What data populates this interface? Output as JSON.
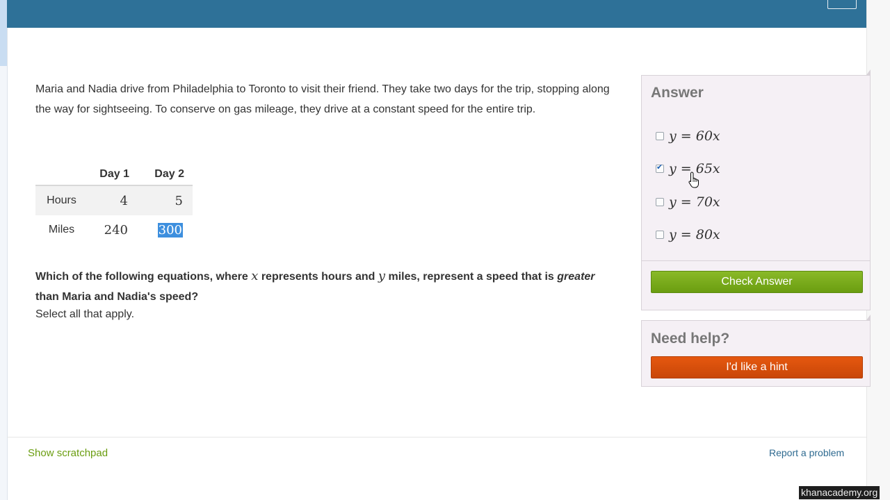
{
  "question": {
    "paragraph": "Maria and Nadia drive from Philadelphia to Toronto to visit their friend. They take two days for the trip, stopping along the way for sightseeing. To conserve on gas mileage, they drive at a constant speed for the entire trip."
  },
  "table": {
    "headers": [
      "",
      "Day 1",
      "Day 2"
    ],
    "rows": [
      {
        "label": "Hours",
        "day1": "4",
        "day2": "5"
      },
      {
        "label": "Miles",
        "day1": "240",
        "day2": "300"
      }
    ]
  },
  "prompt": {
    "part1": "Which of the following equations, where ",
    "x": "x",
    "part2": " represents hours and ",
    "y": "y",
    "part3": " miles, represent a speed that is ",
    "emph": "greater",
    "part4": " than Maria and Nadia's speed?",
    "instruction": "Select all that apply."
  },
  "answer_panel": {
    "title": "Answer",
    "choices": [
      {
        "label": "y = 60x",
        "checked": false
      },
      {
        "label": "y = 65x",
        "checked": true
      },
      {
        "label": "y = 70x",
        "checked": false
      },
      {
        "label": "y = 80x",
        "checked": false
      }
    ],
    "check_button": "Check Answer"
  },
  "help_panel": {
    "title": "Need help?",
    "hint_button": "I'd like a hint"
  },
  "footer": {
    "scratchpad_link": "Show scratchpad",
    "report_link": "Report a problem"
  },
  "watermark": "khanacademy.org",
  "colors": {
    "header": "#2e7198",
    "check_button": "#7aab1c",
    "hint_button": "#d9520c",
    "link_green": "#6a9d10",
    "link_blue": "#2e6a90"
  }
}
